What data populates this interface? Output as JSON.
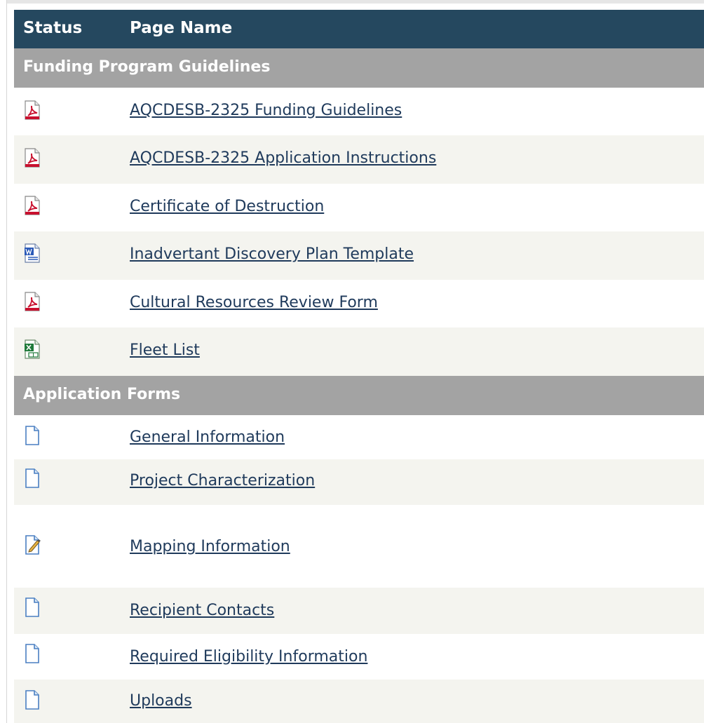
{
  "header": {
    "status": "Status",
    "page_name": "Page Name"
  },
  "sections": [
    {
      "title": "Funding Program Guidelines",
      "items": [
        {
          "label": "AQCDESB-2325 Funding Guidelines",
          "icon": "pdf-icon"
        },
        {
          "label": "AQCDESB-2325 Application Instructions",
          "icon": "pdf-icon"
        },
        {
          "label": "Certificate of Destruction",
          "icon": "pdf-icon"
        },
        {
          "label": "Inadvertant Discovery Plan Template",
          "icon": "word-doc-icon"
        },
        {
          "label": "Cultural Resources Review Form",
          "icon": "pdf-icon"
        },
        {
          "label": "Fleet List",
          "icon": "excel-icon"
        }
      ]
    },
    {
      "title": "Application Forms",
      "items": [
        {
          "label": "General Information",
          "icon": "blank-page-icon"
        },
        {
          "label": "Project Characterization",
          "icon": "blank-page-icon"
        },
        {
          "label": "Mapping Information",
          "icon": "edit-page-icon"
        },
        {
          "label": "Recipient Contacts",
          "icon": "blank-page-icon"
        },
        {
          "label": "Required Eligibility Information",
          "icon": "blank-page-icon"
        },
        {
          "label": "Uploads",
          "icon": "blank-page-icon"
        }
      ]
    }
  ],
  "colors": {
    "header_bg": "#25485f",
    "section_bg": "#a3a3a3",
    "alt_row_bg": "#f4f4ef",
    "link": "#1f3a5b"
  }
}
